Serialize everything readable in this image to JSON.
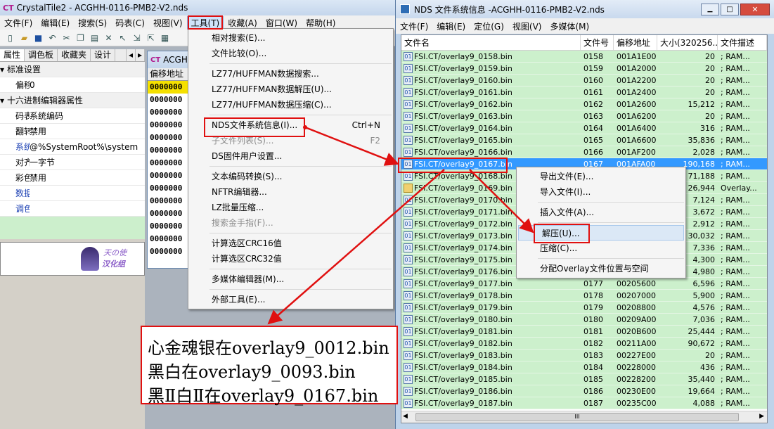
{
  "main_window": {
    "title": "CrystalTile2 - ACGHH-0116-PMB2-V2.nds",
    "app_icon_text": "CT",
    "menu": [
      "文件(F)",
      "编辑(E)",
      "搜索(S)",
      "码表(C)",
      "视图(V)",
      "工具(T)",
      "收藏(A)",
      "窗口(W)",
      "帮助(H)"
    ],
    "tabs": [
      "属性",
      "调色板",
      "收藏夹",
      "设计"
    ],
    "properties": [
      {
        "type": "cat",
        "label": "标准设置"
      },
      {
        "type": "row",
        "key": "偏移地",
        "value": "0"
      },
      {
        "type": "cat",
        "label": "十六进制编辑器属性"
      },
      {
        "type": "row",
        "key": "码表显:",
        "value": "系统编码"
      },
      {
        "type": "row",
        "key": "翻转编",
        "value": "禁用"
      },
      {
        "type": "row",
        "key": "系统编码",
        "value": "@%SystemRoot%\\system",
        "blue": true
      },
      {
        "type": "row",
        "key": "对齐",
        "value": "一字节"
      },
      {
        "type": "row",
        "key": "彩色显:",
        "value": "禁用"
      },
      {
        "type": "row",
        "key": "数据转换",
        "value": "",
        "blue": true
      },
      {
        "type": "row",
        "key": "调色板属",
        "value": "",
        "blue": true
      }
    ],
    "logo_text": [
      "天の使",
      "汉化组"
    ]
  },
  "hex_window": {
    "title": "ACGH",
    "header": "偏移地址",
    "rows": [
      "0000000",
      "0000000",
      "0000000",
      "0000000",
      "0000000",
      "0000000",
      "0000000",
      "0000000",
      "0000000",
      "0000000",
      "0000000",
      "0000000",
      "0000000",
      "0000000"
    ]
  },
  "tools_menu": {
    "items": [
      {
        "label": "相对搜索(E)..."
      },
      {
        "label": "文件比较(O)..."
      },
      {
        "sep": true
      },
      {
        "label": "LZ77/HUFFMAN数据搜索..."
      },
      {
        "label": "LZ77/HUFFMAN数据解压(U)..."
      },
      {
        "label": "LZ77/HUFFMAN数据压缩(C)..."
      },
      {
        "sep": true
      },
      {
        "label": "NDS文件系统信息(I)...",
        "shortcut": "Ctrl+N",
        "highlight": true
      },
      {
        "label": "子文件列表(S)...",
        "shortcut": "F2",
        "disabled": true
      },
      {
        "label": "DS固件用户设置..."
      },
      {
        "sep": true
      },
      {
        "label": "文本编码转换(S)..."
      },
      {
        "label": "NFTR编辑器..."
      },
      {
        "label": "LZ批量压缩..."
      },
      {
        "label": "搜索金手指(F)...",
        "disabled": true
      },
      {
        "sep": true
      },
      {
        "label": "计算选区CRC16值"
      },
      {
        "label": "计算选区CRC32值"
      },
      {
        "sep": true
      },
      {
        "label": "多媒体编辑器(M)..."
      },
      {
        "sep": true
      },
      {
        "label": "外部工具(E)..."
      }
    ]
  },
  "nds_window": {
    "title": "NDS 文件系统信息 -ACGHH-0116-PMB2-V2.nds",
    "menu": [
      "文件(F)",
      "编辑(E)",
      "定位(G)",
      "视图(V)",
      "多媒体(M)"
    ],
    "columns": [
      "文件名",
      "文件号",
      "偏移地址",
      "大小(320256...",
      "文件描述"
    ],
    "rows": [
      [
        "FSI.CT/overlay9_0158.bin",
        "0158",
        "001A1E00",
        "20",
        "; RAM..."
      ],
      [
        "FSI.CT/overlay9_0159.bin",
        "0159",
        "001A2000",
        "20",
        "; RAM..."
      ],
      [
        "FSI.CT/overlay9_0160.bin",
        "0160",
        "001A2200",
        "20",
        "; RAM..."
      ],
      [
        "FSI.CT/overlay9_0161.bin",
        "0161",
        "001A2400",
        "20",
        "; RAM..."
      ],
      [
        "FSI.CT/overlay9_0162.bin",
        "0162",
        "001A2600",
        "15,212",
        "; RAM..."
      ],
      [
        "FSI.CT/overlay9_0163.bin",
        "0163",
        "001A6200",
        "20",
        "; RAM..."
      ],
      [
        "FSI.CT/overlay9_0164.bin",
        "0164",
        "001A6400",
        "316",
        "; RAM..."
      ],
      [
        "FSI.CT/overlay9_0165.bin",
        "0165",
        "001A6600",
        "35,836",
        "; RAM..."
      ],
      [
        "FSI.CT/overlay9_0166.bin",
        "0166",
        "001AF200",
        "2,028",
        "; RAM..."
      ],
      [
        "FSI.CT/overlay9_0167.bin",
        "0167",
        "001AFA00",
        "190,168",
        "; RAM..."
      ],
      [
        "FSI.CT/overlay9_0168.bin",
        "",
        "",
        "71,188",
        "; RAM..."
      ],
      [
        "FSI.CT/overlay9_0169.bin",
        "",
        "",
        "26,944",
        "Overlay..."
      ],
      [
        "FSI.CT/overlay9_0170.bin",
        "",
        "",
        "7,124",
        "; RAM..."
      ],
      [
        "FSI.CT/overlay9_0171.bin",
        "",
        "",
        "3,672",
        "; RAM..."
      ],
      [
        "FSI.CT/overlay9_0172.bin",
        "",
        "",
        "2,912",
        "; RAM..."
      ],
      [
        "FSI.CT/overlay9_0173.bin",
        "",
        "",
        "30,032",
        "; RAM..."
      ],
      [
        "FSI.CT/overlay9_0174.bin",
        "",
        "",
        "7,336",
        "; RAM..."
      ],
      [
        "FSI.CT/overlay9_0175.bin",
        "",
        "",
        "4,300",
        "; RAM..."
      ],
      [
        "FSI.CT/overlay9_0176.bin",
        "",
        "",
        "4,980",
        "; RAM..."
      ],
      [
        "FSI.CT/overlay9_0177.bin",
        "0177",
        "00205600",
        "6,596",
        "; RAM..."
      ],
      [
        "FSI.CT/overlay9_0178.bin",
        "0178",
        "00207000",
        "5,900",
        "; RAM..."
      ],
      [
        "FSI.CT/overlay9_0179.bin",
        "0179",
        "00208800",
        "4,576",
        "; RAM..."
      ],
      [
        "FSI.CT/overlay9_0180.bin",
        "0180",
        "00209A00",
        "7,036",
        "; RAM..."
      ],
      [
        "FSI.CT/overlay9_0181.bin",
        "0181",
        "0020B600",
        "25,444",
        "; RAM..."
      ],
      [
        "FSI.CT/overlay9_0182.bin",
        "0182",
        "00211A00",
        "90,672",
        "; RAM..."
      ],
      [
        "FSI.CT/overlay9_0183.bin",
        "0183",
        "00227E00",
        "20",
        "; RAM..."
      ],
      [
        "FSI.CT/overlay9_0184.bin",
        "0184",
        "00228000",
        "436",
        "; RAM..."
      ],
      [
        "FSI.CT/overlay9_0185.bin",
        "0185",
        "00228200",
        "35,440",
        "; RAM..."
      ],
      [
        "FSI.CT/overlay9_0186.bin",
        "0186",
        "00230E00",
        "19,664",
        "; RAM..."
      ],
      [
        "FSI.CT/overlay9_0187.bin",
        "0187",
        "00235C00",
        "4,088",
        "; RAM..."
      ]
    ],
    "selected_index": 9
  },
  "context_menu": {
    "items": [
      {
        "label": "导出文件(E)..."
      },
      {
        "label": "导入文件(I)..."
      },
      {
        "sep": true
      },
      {
        "label": "插入文件(A)..."
      },
      {
        "sep": true
      },
      {
        "label": "解压(U)...",
        "highlight": true
      },
      {
        "label": "压缩(C)..."
      },
      {
        "sep": true
      },
      {
        "label": "分配Overlay文件位置与空间"
      }
    ]
  },
  "annotation": {
    "lines": [
      "心金魂银在overlay9_0012.bin",
      "黑白在overlay9_0093.bin",
      "黑Ⅱ白Ⅱ在overlay9_0167.bin"
    ]
  },
  "colors": {
    "highlight_red": "#e01010",
    "list_green": "#ccf0cc",
    "selection_blue": "#3399ff"
  }
}
